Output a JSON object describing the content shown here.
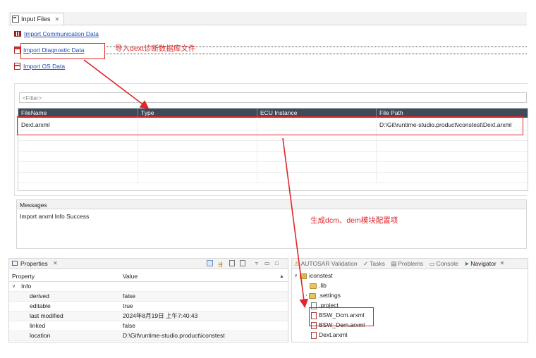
{
  "editor": {
    "tab_label": "Input Files",
    "links": {
      "communication": "Import Communication Data",
      "diagnostic": "Import Diagnostic Data",
      "os": "Import OS Data"
    },
    "filter_placeholder": "<Filter>",
    "table": {
      "headers": [
        "FileName",
        "Type",
        "ECU Instance",
        "File Path"
      ],
      "rows": [
        {
          "filename": "Dext.arxml",
          "type": "",
          "ecu": "",
          "path": "D:\\Git\\runtime-studio.product\\iconstest\\Dext.arxml"
        }
      ]
    },
    "messages_title": "Messages",
    "messages_text": "Import arxml Info Success"
  },
  "annotations": {
    "import_dext": "导入dext诊断数据库文件",
    "generate_dcm_dem": "生成dcm、dem模块配置项",
    "color": "#e0262a"
  },
  "properties": {
    "title": "Properties",
    "col_property": "Property",
    "col_value": "Value",
    "group": "Info",
    "rows": [
      {
        "name": "derived",
        "value": "false"
      },
      {
        "name": "editable",
        "value": "true"
      },
      {
        "name": "last modified",
        "value": "2024年8月19日 上午7:40:43"
      },
      {
        "name": "linked",
        "value": "false"
      },
      {
        "name": "location",
        "value": "D:\\Git\\runtime-studio.product\\iconstest"
      }
    ]
  },
  "navigator": {
    "tabs": [
      "AUTOSAR Validation",
      "Tasks",
      "Problems",
      "Console",
      "Navigator"
    ],
    "project": "iconstest",
    "items": [
      ".lib",
      ".settings",
      ".project",
      "BSW_Dcm.arxml",
      "BSW_Dem.arxml",
      "Dext.arxml"
    ]
  }
}
